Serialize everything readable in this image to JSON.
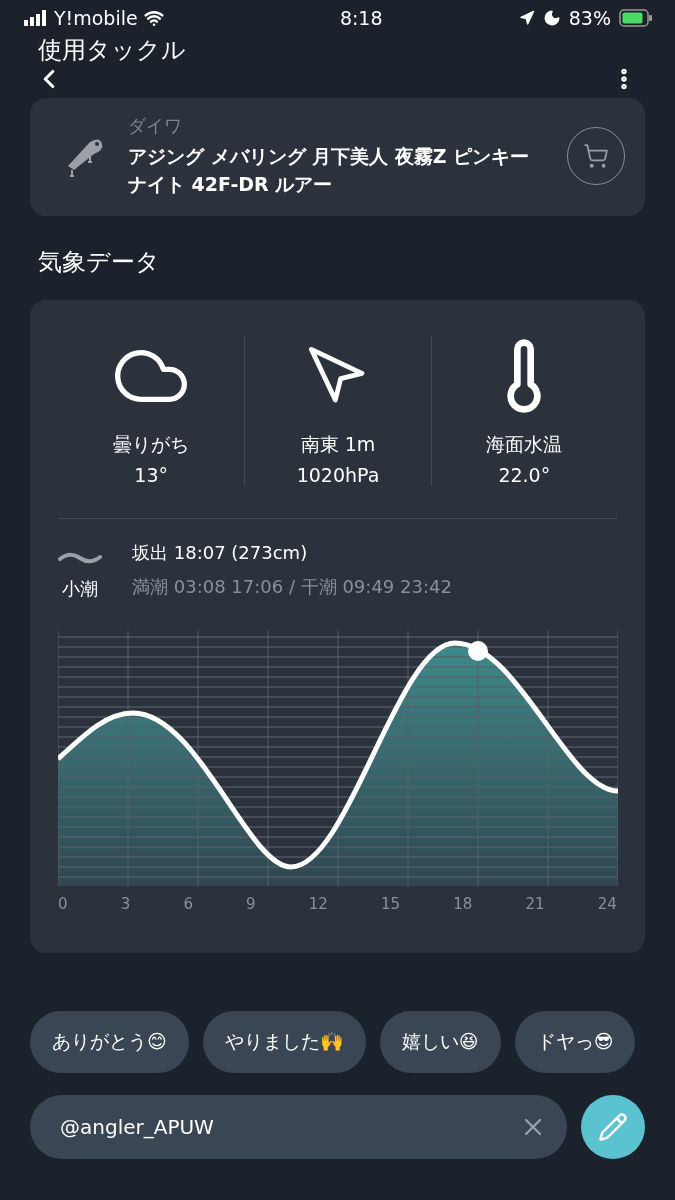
{
  "status_bar": {
    "carrier": "Y!mobile",
    "time": "8:18",
    "battery": "83%"
  },
  "header": {
    "title": "使用タックル"
  },
  "tackle": {
    "brand": "ダイワ",
    "name": "アジング メバリング 月下美人 夜霧Z ピンキーナイト 42F-DR ルアー"
  },
  "weather": {
    "title": "気象データ",
    "stats": [
      {
        "kind": "cloud",
        "label": "曇りがち",
        "value": "13°"
      },
      {
        "kind": "wind",
        "label": "南東 1m",
        "value": "1020hPa"
      },
      {
        "kind": "temperature",
        "label": "海面水温",
        "value": "22.0°"
      }
    ],
    "tide": {
      "name": "小潮",
      "place_time": "坂出 18:07 (273cm)",
      "times": "満潮 03:08 17:06 / 干潮 09:49 23:42",
      "x_labels": [
        "0",
        "3",
        "6",
        "9",
        "12",
        "15",
        "18",
        "21",
        "24"
      ]
    }
  },
  "chips": [
    {
      "label": "ありがとう😊"
    },
    {
      "label": "やりました🙌"
    },
    {
      "label": "嬉しい😆"
    },
    {
      "label": "ドヤっ😎"
    }
  ],
  "input": {
    "value": "@angler_APUW"
  }
}
